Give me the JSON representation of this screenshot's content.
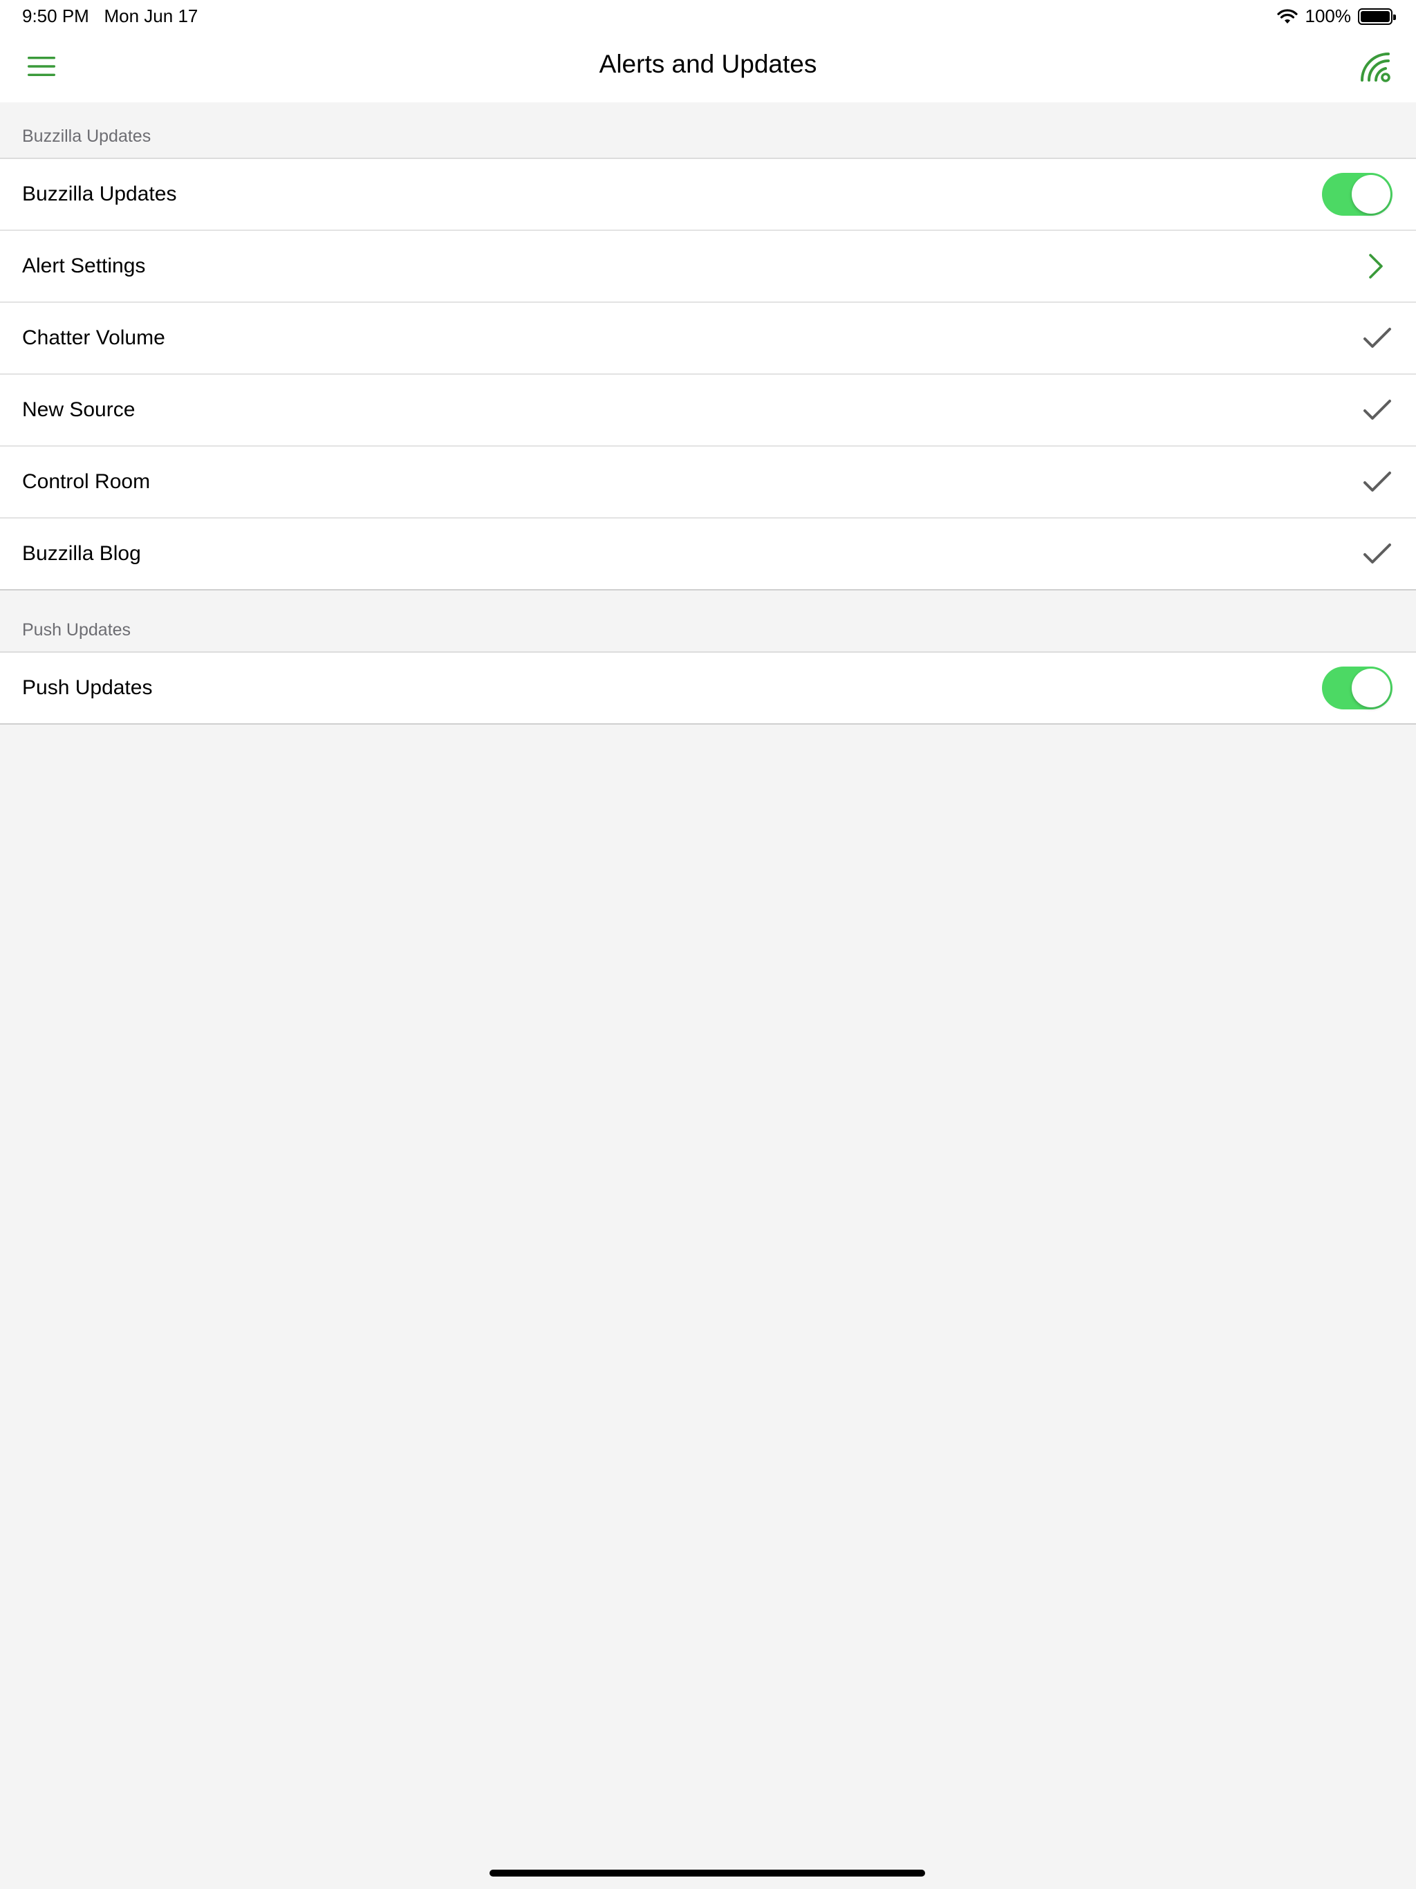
{
  "status_bar": {
    "time": "9:50 PM",
    "date": "Mon Jun 17",
    "battery": "100%",
    "icons": [
      "wifi-icon",
      "battery-icon"
    ]
  },
  "nav": {
    "title": "Alerts and Updates",
    "left_icon": "menu-icon",
    "right_icon": "feed-icon"
  },
  "colors": {
    "accent": "#3a9a3a",
    "toggle_on": "#4cd964",
    "checkmark": "#5e5e5e",
    "background": "#f4f4f4"
  },
  "sections": [
    {
      "header": "Buzzilla Updates",
      "rows": [
        {
          "label": "Buzzilla Updates",
          "accessory": "toggle",
          "on": true
        },
        {
          "label": "Alert Settings",
          "accessory": "chevron-right-icon"
        },
        {
          "label": "Chatter Volume",
          "accessory": "checkmark-icon"
        },
        {
          "label": "New Source",
          "accessory": "checkmark-icon"
        },
        {
          "label": "Control Room",
          "accessory": "checkmark-icon"
        },
        {
          "label": "Buzzilla Blog",
          "accessory": "checkmark-icon"
        }
      ]
    },
    {
      "header": "Push Updates",
      "rows": [
        {
          "label": "Push Updates",
          "accessory": "toggle",
          "on": true
        }
      ]
    }
  ]
}
